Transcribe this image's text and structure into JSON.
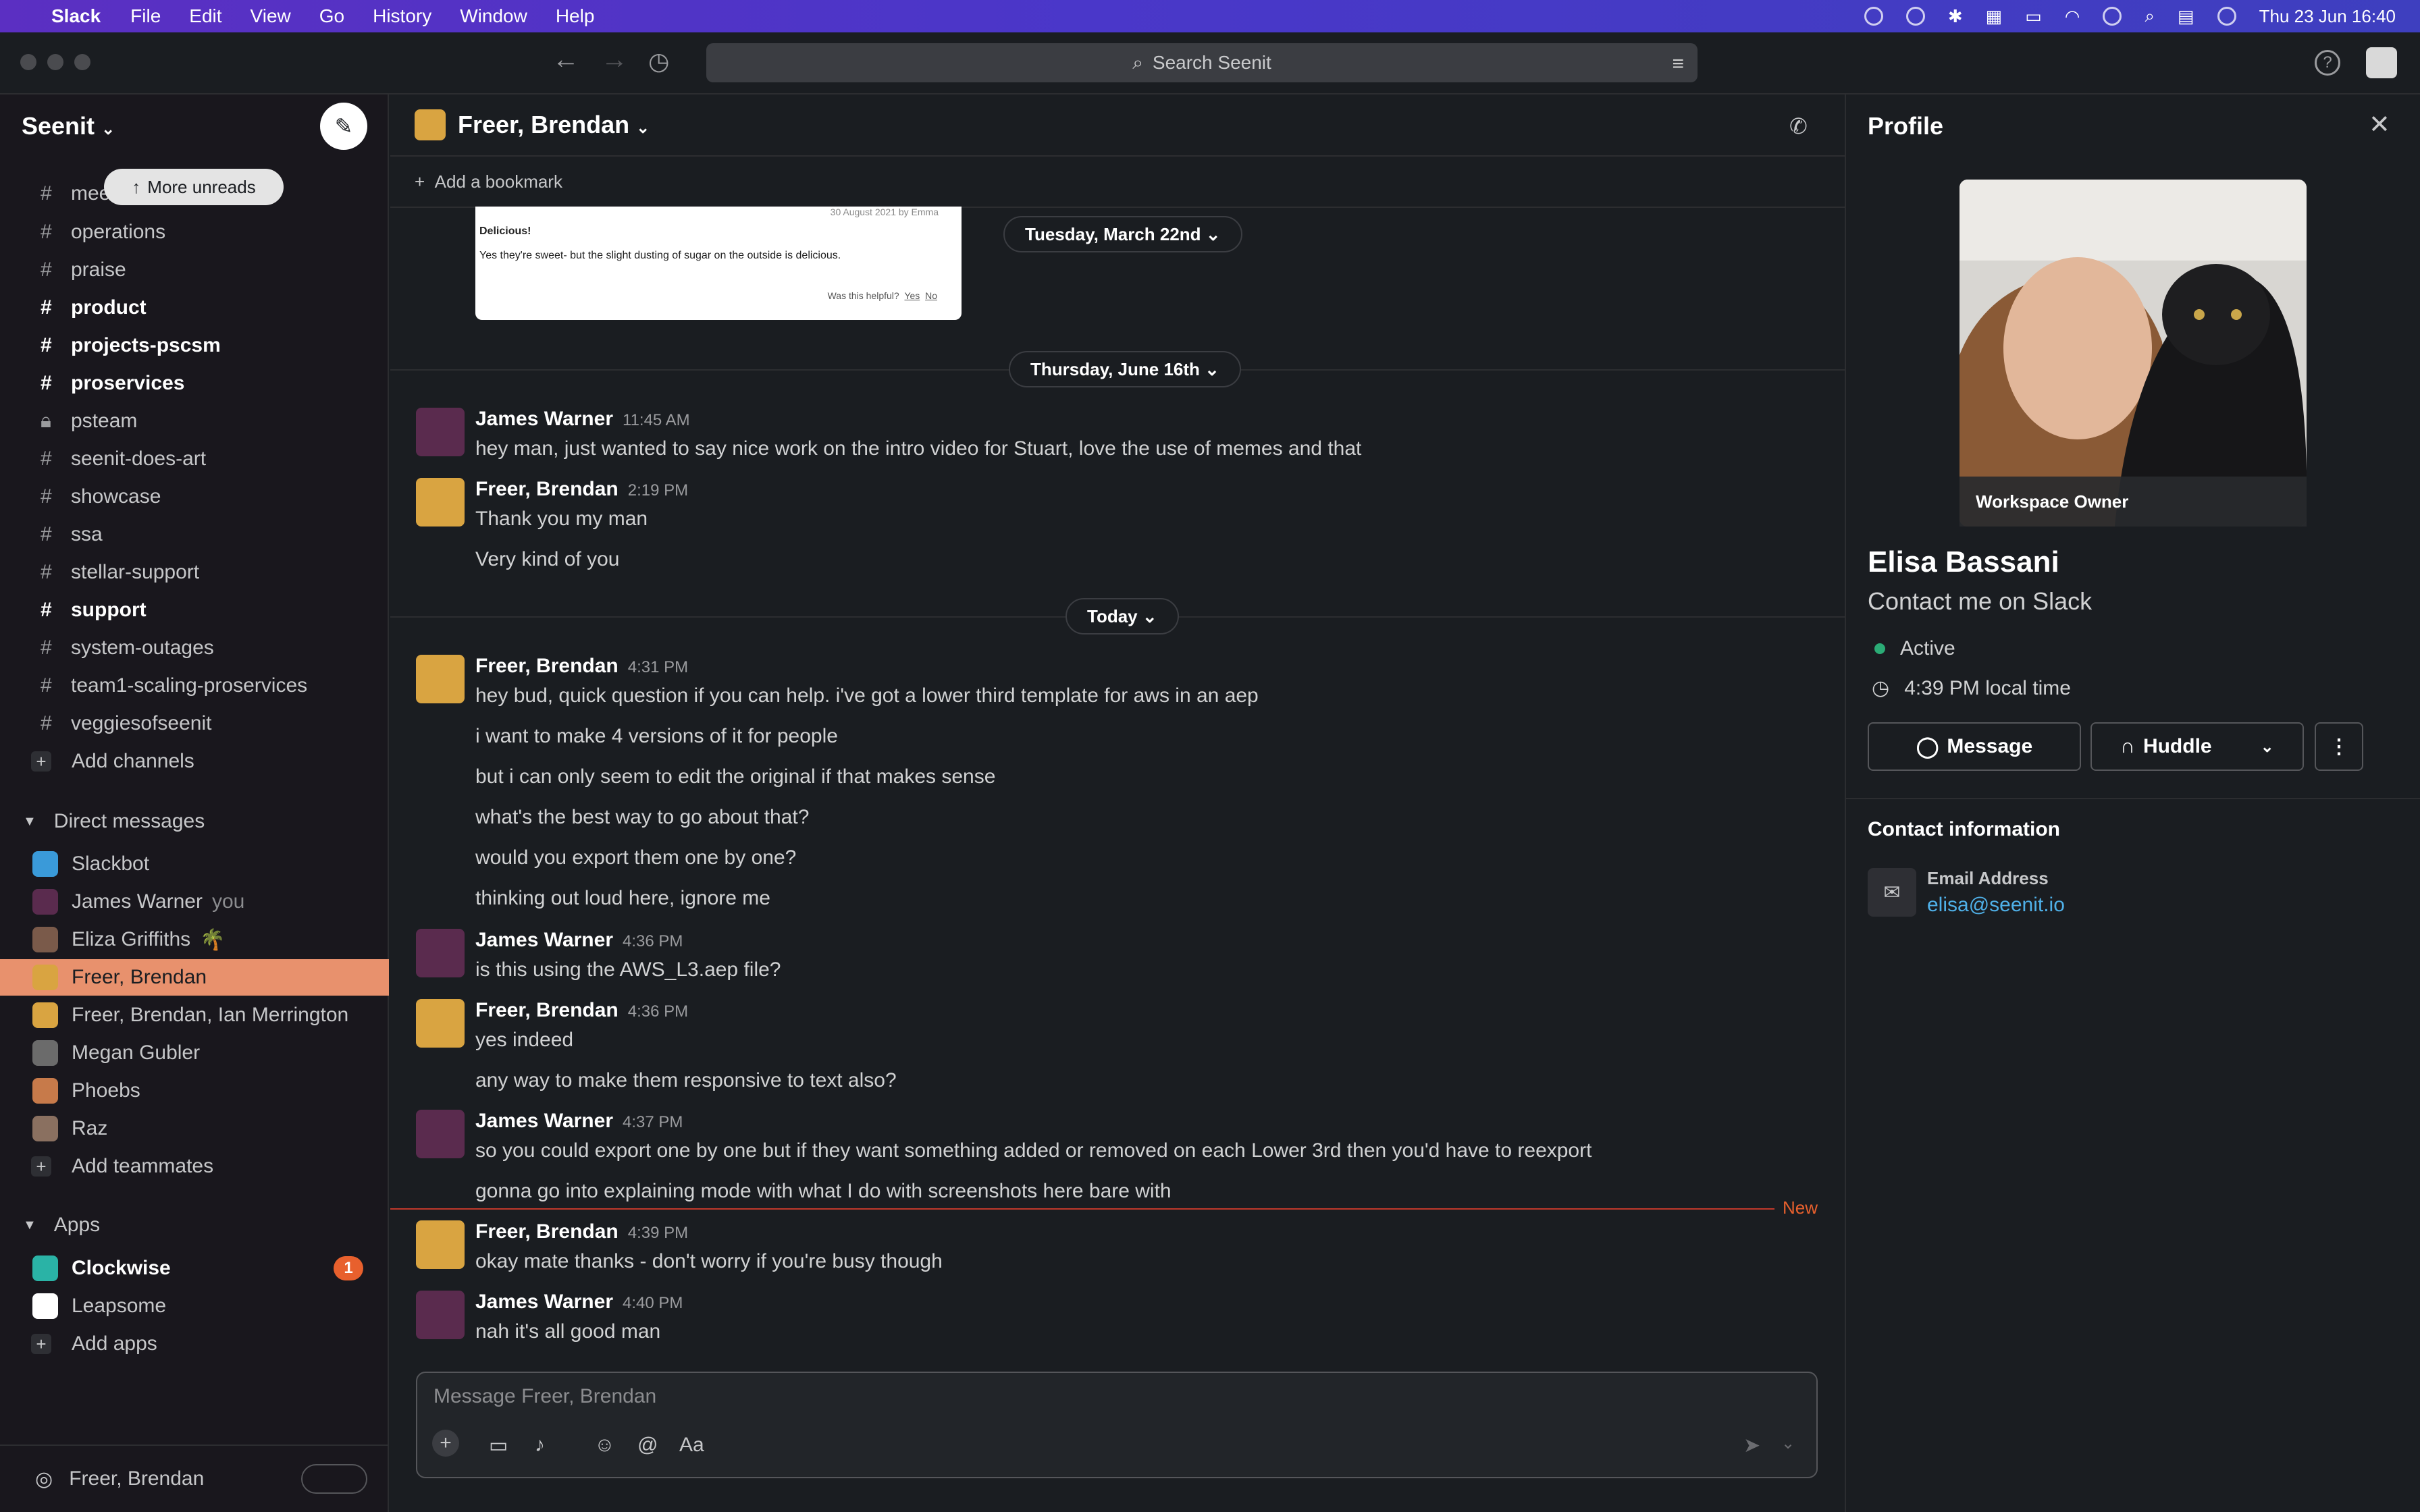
{
  "menubar": {
    "app": "Slack",
    "items": [
      "File",
      "Edit",
      "View",
      "Go",
      "History",
      "Window",
      "Help"
    ],
    "datetime": "Thu 23 Jun  16:40"
  },
  "toolbar": {
    "search_placeholder": "Search Seenit"
  },
  "sidebar": {
    "workspace": "Seenit",
    "more_unreads": "More unreads",
    "channels": [
      {
        "label": "mee",
        "bold": false,
        "icon": "hash"
      },
      {
        "label": "operations",
        "bold": false,
        "icon": "hash"
      },
      {
        "label": "praise",
        "bold": false,
        "icon": "hash"
      },
      {
        "label": "product",
        "bold": true,
        "icon": "hash"
      },
      {
        "label": "projects-pscsm",
        "bold": true,
        "icon": "hash"
      },
      {
        "label": "proservices",
        "bold": true,
        "icon": "hash"
      },
      {
        "label": "psteam",
        "bold": false,
        "icon": "lock"
      },
      {
        "label": "seenit-does-art",
        "bold": false,
        "icon": "hash"
      },
      {
        "label": "showcase",
        "bold": false,
        "icon": "hash"
      },
      {
        "label": "ssa",
        "bold": false,
        "icon": "hash"
      },
      {
        "label": "stellar-support",
        "bold": false,
        "icon": "hash"
      },
      {
        "label": "support",
        "bold": true,
        "icon": "hash"
      },
      {
        "label": "system-outages",
        "bold": false,
        "icon": "hash"
      },
      {
        "label": "team1-scaling-proservices",
        "bold": false,
        "icon": "hash"
      },
      {
        "label": "veggiesofseenit",
        "bold": false,
        "icon": "hash"
      }
    ],
    "add_channels": "Add channels",
    "dm_header": "Direct messages",
    "dms": [
      {
        "label": "Slackbot",
        "extra": "",
        "color": "#3a9ad9"
      },
      {
        "label": "James Warner",
        "extra": "you",
        "color": "#5a2b4e"
      },
      {
        "label": "Eliza Griffiths",
        "extra": "🌴",
        "color": "#7a5a4a"
      },
      {
        "label": "Freer, Brendan",
        "extra": "",
        "color": "#d9a441"
      },
      {
        "label": "Freer, Brendan, Ian Merrington",
        "extra": "",
        "color": "#d9a441"
      },
      {
        "label": "Megan Gubler",
        "extra": "",
        "color": "#6b6b6b"
      },
      {
        "label": "Phoebs",
        "extra": "",
        "color": "#c77a4a"
      },
      {
        "label": "Raz",
        "extra": "",
        "color": "#8a7060"
      }
    ],
    "add_teammates": "Add teammates",
    "apps_header": "Apps",
    "apps": [
      {
        "label": "Clockwise",
        "bold": true,
        "badge": "1",
        "color": "#2ab3a6"
      },
      {
        "label": "Leapsome",
        "bold": false,
        "badge": "",
        "color": "#ffffff"
      }
    ],
    "add_apps": "Add apps",
    "footer_name": "Freer, Brendan"
  },
  "channel": {
    "title": "Freer, Brendan",
    "add_bookmark": "Add a bookmark"
  },
  "preview": {
    "heading": "Delicious!",
    "body": "Yes they're sweet- but the slight dusting of sugar on the outside is delicious.",
    "helpful": "Was this helpful?",
    "yes": "Yes",
    "no": "No",
    "meta": "30 August 2021 by Emma"
  },
  "dates": {
    "d1": "Tuesday, March 22nd",
    "d2": "Thursday, June 16th",
    "d3": "Today"
  },
  "messages": [
    {
      "name": "James Warner",
      "time": "11:45 AM",
      "lines": [
        "hey man, just wanted to say nice work on the intro video for Stuart, love the use of memes and that"
      ]
    },
    {
      "name": "Freer, Brendan",
      "time": "2:19 PM",
      "lines": [
        "Thank you my man",
        "Very kind of you"
      ]
    },
    {
      "name": "Freer, Brendan",
      "time": "4:31 PM",
      "lines": [
        "hey bud, quick question if you can help. i've got a lower third template for aws in an aep",
        "i want to make 4 versions of it for people",
        "but i can only seem to edit the original if that makes sense",
        "what's the best way to go about that?",
        "would you export them one by one?",
        "thinking out loud here, ignore me"
      ]
    },
    {
      "name": "James Warner",
      "time": "4:36 PM",
      "lines": [
        "is this using the AWS_L3.aep file?"
      ]
    },
    {
      "name": "Freer, Brendan",
      "time": "4:36 PM",
      "lines": [
        "yes indeed",
        "any way to make them responsive to text also?"
      ]
    },
    {
      "name": "James Warner",
      "time": "4:37 PM",
      "lines": [
        "so you could export one by one but if they want something added or removed on each Lower 3rd then you'd have to reexport",
        "gonna go into explaining mode with what I do with screenshots here bare with"
      ]
    },
    {
      "name": "Freer, Brendan",
      "time": "4:39 PM",
      "lines": [
        "okay mate thanks - don't worry if you're busy though"
      ]
    },
    {
      "name": "James Warner",
      "time": "4:40 PM",
      "lines": [
        "nah it's all good man"
      ]
    }
  ],
  "new_label": "New",
  "composer": {
    "placeholder": "Message Freer, Brendan"
  },
  "profile": {
    "title": "Profile",
    "owner_tag": "Workspace Owner",
    "name": "Elisa Bassani",
    "status": "Contact me on Slack",
    "presence": "Active",
    "local_time": "4:39 PM local time",
    "message_btn": "Message",
    "huddle_btn": "Huddle",
    "contact_header": "Contact information",
    "email_label": "Email Address",
    "email": "elisa@seenit.io"
  }
}
